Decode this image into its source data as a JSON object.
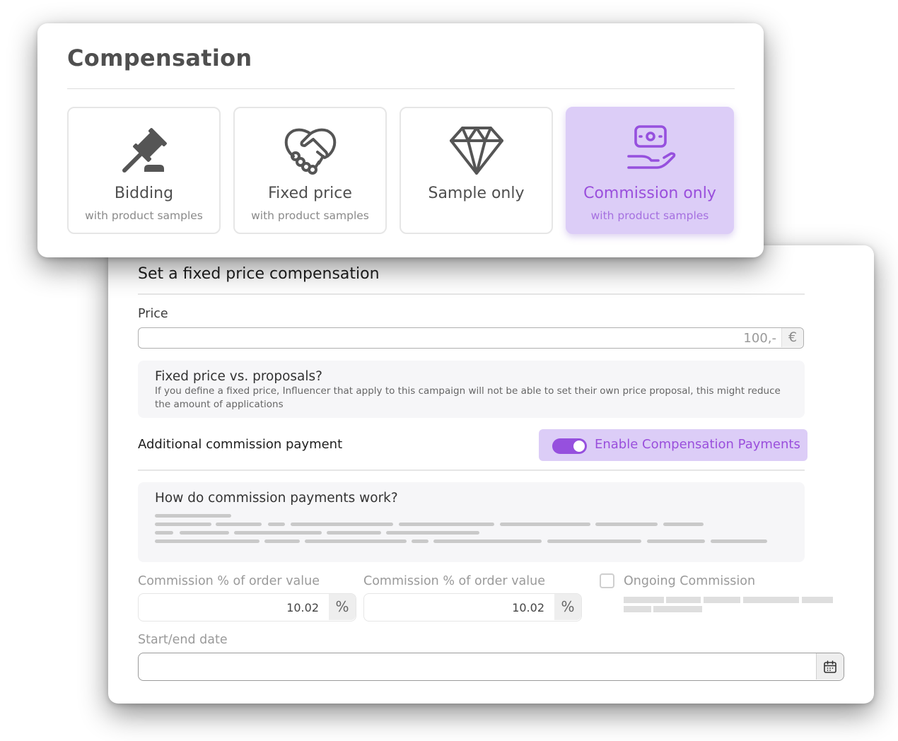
{
  "compensation_card": {
    "title": "Compensation",
    "options": [
      {
        "title": "Bidding",
        "subtitle": "with product samples",
        "icon": "gavel-icon",
        "selected": false
      },
      {
        "title": "Fixed price",
        "subtitle": "with product samples",
        "icon": "handshake-icon",
        "selected": false
      },
      {
        "title": "Sample only",
        "subtitle": "",
        "icon": "diamond-icon",
        "selected": false
      },
      {
        "title": "Commission only",
        "subtitle": "with product samples",
        "icon": "money-in-hand-icon",
        "selected": true
      }
    ]
  },
  "fixed_price_card": {
    "title": "Set a fixed price compensation",
    "price": {
      "label": "Price",
      "value": "100,-",
      "unit": "€"
    },
    "info_fixed": {
      "title": "Fixed price vs. proposals?",
      "body": "If you define a fixed price, Influencer that apply to this campaign will not be able to set their own price proposal, this might reduce the amount of applications"
    },
    "additional_commission": {
      "label": "Additional commission payment",
      "toggle_label": "Enable Compensation Payments",
      "toggle_on": true
    },
    "info_commission": {
      "title": "How do commission payments work?"
    },
    "commission_fields": [
      {
        "label": "Commission % of order value",
        "value": "10.02",
        "unit": "%"
      },
      {
        "label": "Commission % of order value",
        "value": "10.02",
        "unit": "%"
      }
    ],
    "ongoing": {
      "label": "Ongoing Commission",
      "checked": false
    },
    "date": {
      "label": "Start/end date",
      "value": "",
      "icon": "calendar-icon"
    }
  },
  "colors": {
    "accent": "#9650de",
    "accent_light": "#dccdf7",
    "accent_text": "#9a4fdc"
  }
}
